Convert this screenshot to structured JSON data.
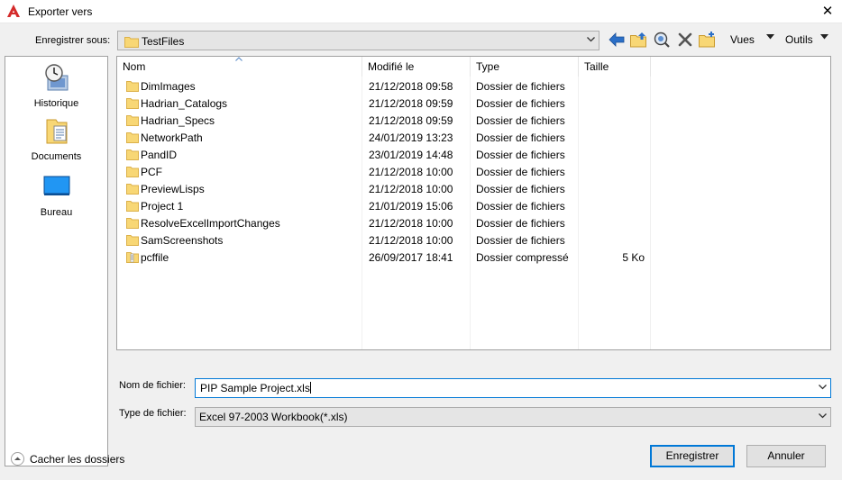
{
  "window": {
    "title": "Exporter vers",
    "close_glyph": "✕"
  },
  "location": {
    "label": "Enregistrer sous:",
    "value": "TestFiles"
  },
  "toolbar": {
    "back_icon": "back-arrow-icon",
    "up_icon": "folder-up-icon",
    "search_icon": "search-web-icon",
    "delete_icon": "delete-x-icon",
    "new_folder_icon": "new-folder-icon",
    "views_label": "Vues",
    "tools_label": "Outils"
  },
  "places": [
    {
      "label": "Historique",
      "icon": "history-clock-icon"
    },
    {
      "label": "Documents",
      "icon": "documents-folder-icon"
    },
    {
      "label": "Bureau",
      "icon": "desktop-monitor-icon"
    }
  ],
  "columns": {
    "name": "Nom",
    "modified": "Modifié le",
    "type": "Type",
    "size": "Taille"
  },
  "files": [
    {
      "name": "DimImages",
      "modified": "21/12/2018 09:58",
      "type": "Dossier de fichiers",
      "size": "",
      "icon": "folder-icon"
    },
    {
      "name": "Hadrian_Catalogs",
      "modified": "21/12/2018 09:59",
      "type": "Dossier de fichiers",
      "size": "",
      "icon": "folder-icon"
    },
    {
      "name": "Hadrian_Specs",
      "modified": "21/12/2018 09:59",
      "type": "Dossier de fichiers",
      "size": "",
      "icon": "folder-icon"
    },
    {
      "name": "NetworkPath",
      "modified": "24/01/2019 13:23",
      "type": "Dossier de fichiers",
      "size": "",
      "icon": "folder-icon"
    },
    {
      "name": "PandID",
      "modified": "23/01/2019 14:48",
      "type": "Dossier de fichiers",
      "size": "",
      "icon": "folder-icon"
    },
    {
      "name": "PCF",
      "modified": "21/12/2018 10:00",
      "type": "Dossier de fichiers",
      "size": "",
      "icon": "folder-icon"
    },
    {
      "name": "PreviewLisps",
      "modified": "21/12/2018 10:00",
      "type": "Dossier de fichiers",
      "size": "",
      "icon": "folder-icon"
    },
    {
      "name": "Project 1",
      "modified": "21/01/2019 15:06",
      "type": "Dossier de fichiers",
      "size": "",
      "icon": "folder-icon"
    },
    {
      "name": "ResolveExcelImportChanges",
      "modified": "21/12/2018 10:00",
      "type": "Dossier de fichiers",
      "size": "",
      "icon": "folder-icon"
    },
    {
      "name": "SamScreenshots",
      "modified": "21/12/2018 10:00",
      "type": "Dossier de fichiers",
      "size": "",
      "icon": "folder-icon"
    },
    {
      "name": "pcffile",
      "modified": "26/09/2017 18:41",
      "type": "Dossier compressé",
      "size": "5 Ko",
      "icon": "zip-folder-icon"
    }
  ],
  "filename": {
    "label": "Nom de fichier:",
    "value": "PIP Sample Project.xls"
  },
  "filetype": {
    "label": "Type de fichier:",
    "value": "Excel 97-2003 Workbook(*.xls)"
  },
  "hide_folders": {
    "label": "Cacher les dossiers"
  },
  "buttons": {
    "save": "Enregistrer",
    "cancel": "Annuler"
  },
  "colors": {
    "accent": "#0078d7",
    "folder": "#f8d775",
    "folder_edge": "#dcb14a",
    "app_red": "#d42b2b"
  }
}
